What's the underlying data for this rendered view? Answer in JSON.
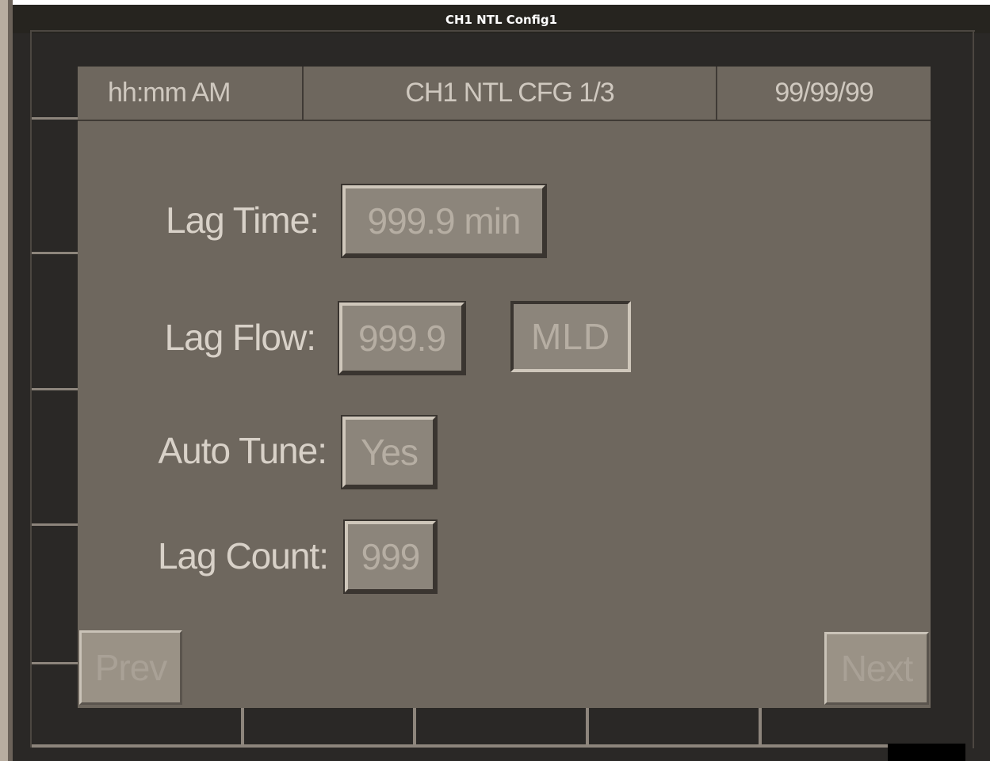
{
  "window": {
    "title": "CH1 NTL Config1"
  },
  "header": {
    "time": "hh:mm AM",
    "screen_title": "CH1 NTL CFG 1/3",
    "date": "99/99/99"
  },
  "fields": {
    "lag_time": {
      "label": "Lag Time:",
      "value": "999.9 min"
    },
    "lag_flow": {
      "label": "Lag Flow:",
      "value": "999.9",
      "unit": "MLD"
    },
    "auto_tune": {
      "label": "Auto Tune:",
      "value": "Yes"
    },
    "lag_count": {
      "label": "Lag Count:",
      "value": "999"
    }
  },
  "nav": {
    "prev_label": "Prev",
    "next_label": "Next"
  },
  "colors": {
    "panel": "#6e675e",
    "bezel": "#2a2826",
    "field": "#8c857b",
    "label_text": "#d8d1c8"
  }
}
